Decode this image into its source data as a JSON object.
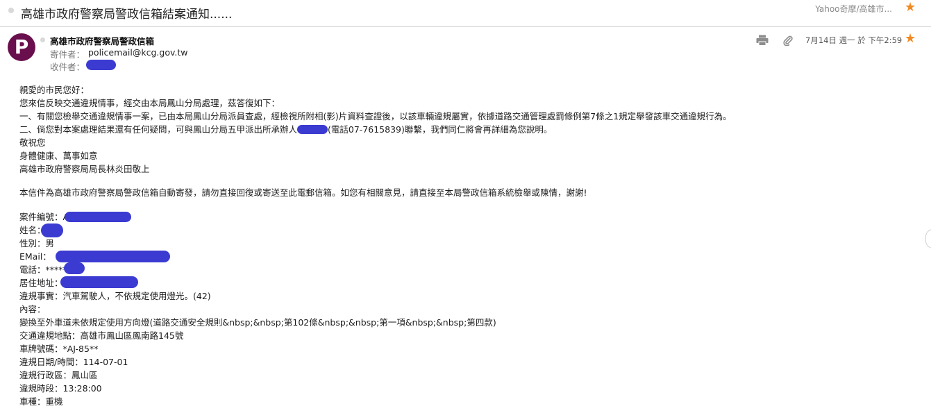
{
  "subject_bar": {
    "subject": "高雄市政府警察局警政信箱結案通知......",
    "folder": "Yahoo奇摩/高雄市..."
  },
  "message_header": {
    "avatar_letter": "P",
    "sender_name": "高雄市政府警察局警政信箱",
    "from_label": "寄件者：",
    "from_address": "policemail@kcg.gov.tw",
    "to_label": "收件者：",
    "date": "7月14日 週一 於 下午2:59"
  },
  "icons": {
    "print": "print-icon",
    "attachment": "paperclip-icon",
    "star": "star-icon"
  },
  "colors": {
    "star": "#f08a24",
    "avatar_bg": "#6a0f4d",
    "redaction": "#3b3bd2"
  },
  "body": {
    "greeting": "親愛的市民您好：",
    "intro": "您來信反映交通違規情事，經交由本局鳳山分局處理，茲答復如下：",
    "point1": "一、有關您檢舉交通違規情事一案，已由本局鳳山分局派員查處，經檢視所附相(影)片資料查證後，以該車輛違規屬實，依據道路交通管理處罰條例第7條之1規定舉發該車交通違規行為。",
    "point2_a": "二、倘您對本案處理結果還有任何疑問，可與鳳山分局五甲派出所承辦人",
    "point2_b": "(電話07-7615839)聯繫，我們同仁將會再詳細為您說明。",
    "closing1": "敬祝您",
    "closing2": "身體健康、萬事如意",
    "signature": "高雄市政府警察局局長林炎田敬上",
    "notice": "本信件為高雄市政府警察局警政信箱自動寄發，請勿直接回復或寄送至此電郵信箱。如您有相關意見，請直接至本局警政信箱系統檢舉或陳情，謝謝!",
    "case_no": "案件編號：A",
    "name": "姓名：",
    "gender": "性別：男",
    "email": "EMail：",
    "phone": "電話：*****",
    "address": "居住地址：",
    "fact": "違規事實：汽車駕駛人，不依規定使用燈光。(42)",
    "content_label": "內容：",
    "content": "變換至外車道未依規定使用方向燈(道路交通安全規則&nbsp;&nbsp;第102條&nbsp;&nbsp;第一項&nbsp;&nbsp;第四款)",
    "location": "交通違規地點：高雄市鳳山區鳳南路145號",
    "plate": "車牌號碼：*AJ-85**",
    "datetime": "違規日期/時間：114-07-01",
    "district": "違規行政區：鳳山區",
    "time": "違規時段：13:28:00",
    "vehicle": "車種：重機"
  }
}
